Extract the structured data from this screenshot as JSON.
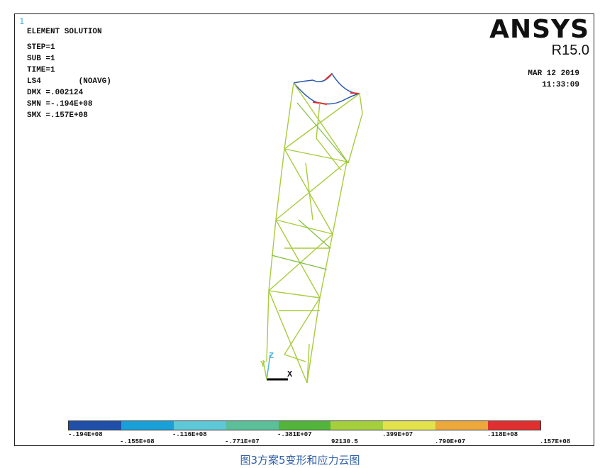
{
  "window_number": "1",
  "info": {
    "title": "ELEMENT SOLUTION",
    "lines": [
      "STEP=1",
      "SUB =1",
      "TIME=1",
      "LS4        (NOAVG)",
      "DMX =.002124",
      "SMN =-.194E+08",
      "SMX =.157E+08"
    ]
  },
  "brand": {
    "logo": "ANSYS",
    "version": "R15.0"
  },
  "timestamp": {
    "date": "MAR 12 2019",
    "time": "11:33:09"
  },
  "axes": {
    "x": "X",
    "y": "Y",
    "z": "Z"
  },
  "legend": {
    "colors": [
      "#1f4fa8",
      "#1aa0d8",
      "#5ec7d8",
      "#5bbf9a",
      "#53b43c",
      "#a5cf3d",
      "#e2e24c",
      "#eca83a",
      "#e02f2f"
    ],
    "labels_top": [
      "-.194E+08",
      "-.116E+08",
      "-.381E+07",
      ".399E+07",
      ".118E+08"
    ],
    "labels_bottom": [
      "-.155E+08",
      "-.771E+07",
      "92130.5",
      ".790E+07",
      ".157E+08"
    ]
  },
  "caption": "图3方案5变形和应力云图"
}
